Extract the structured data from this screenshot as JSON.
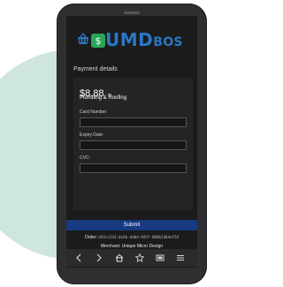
{
  "brand": {
    "logo_text": "UMD",
    "logo_subtext": "BOS",
    "icon_basket": "shopping-basket-icon",
    "icon_dollar": "dollar-icon",
    "colors": {
      "blue": "#2a77c4",
      "green": "#2ca55a"
    }
  },
  "payment": {
    "section_title": "Payment details",
    "amount": "$8.88",
    "amount_suffix": "to",
    "payee": "Plumbing & Roofing",
    "fields": {
      "card_number": {
        "label": "Card Number:",
        "value": "",
        "placeholder": ""
      },
      "expiry_date": {
        "label": "Expiry Date:",
        "value": "",
        "placeholder": ""
      },
      "cvc": {
        "label": "CVC:",
        "value": "",
        "placeholder": ""
      }
    },
    "submit_label": "Submit",
    "order_prefix": "Order:",
    "order_id": "d34cc243-0c6b-4ddd-945f-00061464ef54",
    "merchant": "Merchant: Unique Micro Design",
    "links": "Deliveries & Shipments",
    "colors": {
      "screen_bg": "#1b1b1b",
      "card_bg": "#242424",
      "submit_bg": "#173a80",
      "link": "#7ea6ff"
    }
  },
  "navbar": {
    "icons": [
      "back-icon",
      "forward-icon",
      "home-icon",
      "star-icon",
      "tabs-icon",
      "menu-icon"
    ]
  },
  "scene": {
    "blob_color": "#cfe6dc",
    "phone_color": "#2f2f31"
  }
}
